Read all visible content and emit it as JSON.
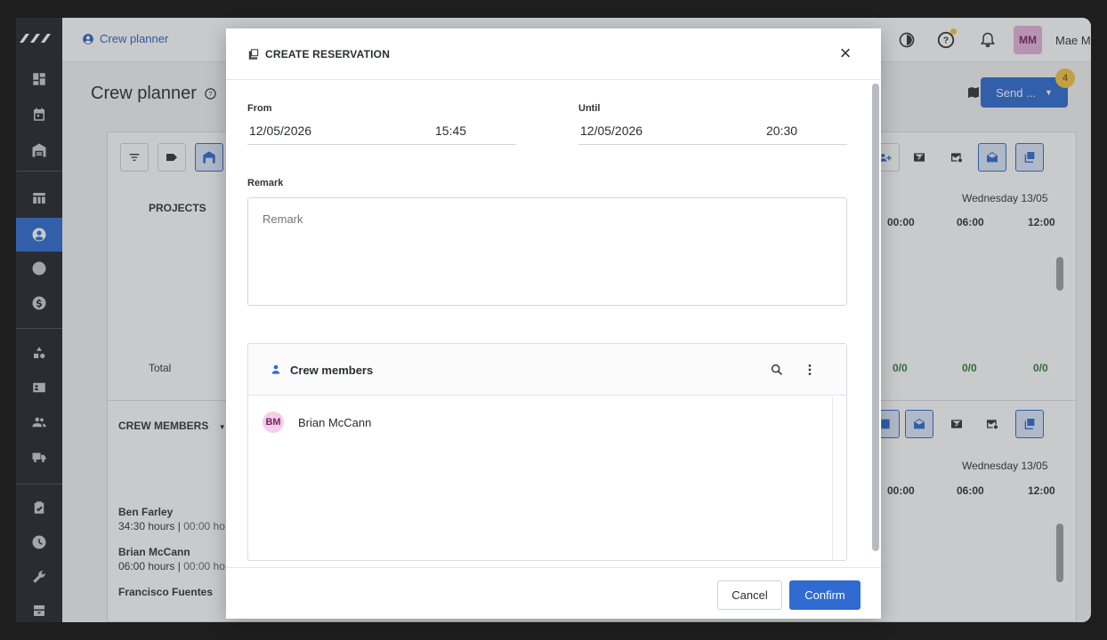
{
  "app": {
    "breadcrumb": "Crew planner",
    "page_title": "Crew planner",
    "user_initials": "MM",
    "user_name": "Mae M",
    "send_label": "Send ...",
    "send_badge": "4"
  },
  "background": {
    "projects_header": "PROJECTS",
    "total_label": "Total",
    "crew_members_header": "CREW MEMBERS",
    "date_label": "Wednesday 13/05",
    "time_slots": [
      "00:00",
      "06:00",
      "12:00"
    ],
    "totals": [
      "0/0",
      "0/0",
      "0/0"
    ],
    "crew": [
      {
        "name": "Ben Farley",
        "hours": "34:30 hours",
        "extra": "00:00 ho"
      },
      {
        "name": "Brian McCann",
        "hours": "06:00 hours",
        "extra": "00:00 ho"
      },
      {
        "name": "Francisco Fuentes",
        "hours": "",
        "extra": ""
      }
    ]
  },
  "modal": {
    "title": "CREATE RESERVATION",
    "from_label": "From",
    "from_date": "12/05/2026",
    "from_time": "15:45",
    "until_label": "Until",
    "until_date": "12/05/2026",
    "until_time": "20:30",
    "remark_label": "Remark",
    "remark_placeholder": "Remark",
    "crew_section_title": "Crew members",
    "crew_list": [
      {
        "initials": "BM",
        "name": "Brian McCann"
      }
    ],
    "cancel_label": "Cancel",
    "confirm_label": "Confirm"
  },
  "colors": {
    "primary": "#2f6bd1",
    "avatar_bg": "#e6b3dd",
    "badge": "#f5c543"
  }
}
